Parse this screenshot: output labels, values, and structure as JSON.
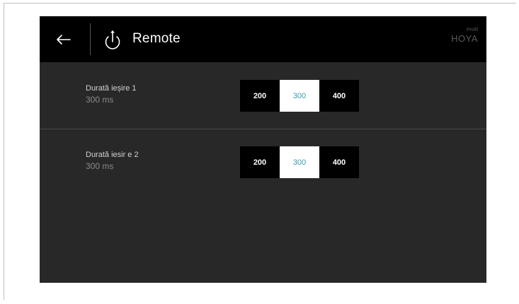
{
  "header": {
    "back_icon": "arrow-left-icon",
    "title_icon": "remote-power-icon",
    "title": "Remote",
    "profile_label": "Profil",
    "profile_name": "HOYA"
  },
  "settings": [
    {
      "label": "Durată ieșire 1",
      "value": "300 ms",
      "options": [
        "200",
        "300",
        "400"
      ],
      "selected": "300"
    },
    {
      "label": "Durată iesir e 2",
      "value": "300 ms",
      "options": [
        "200",
        "300",
        "400"
      ],
      "selected": "300"
    }
  ],
  "colors": {
    "screen_bg": "#282828",
    "topbar_bg": "#000000",
    "selected_text": "#3a9ab0"
  }
}
